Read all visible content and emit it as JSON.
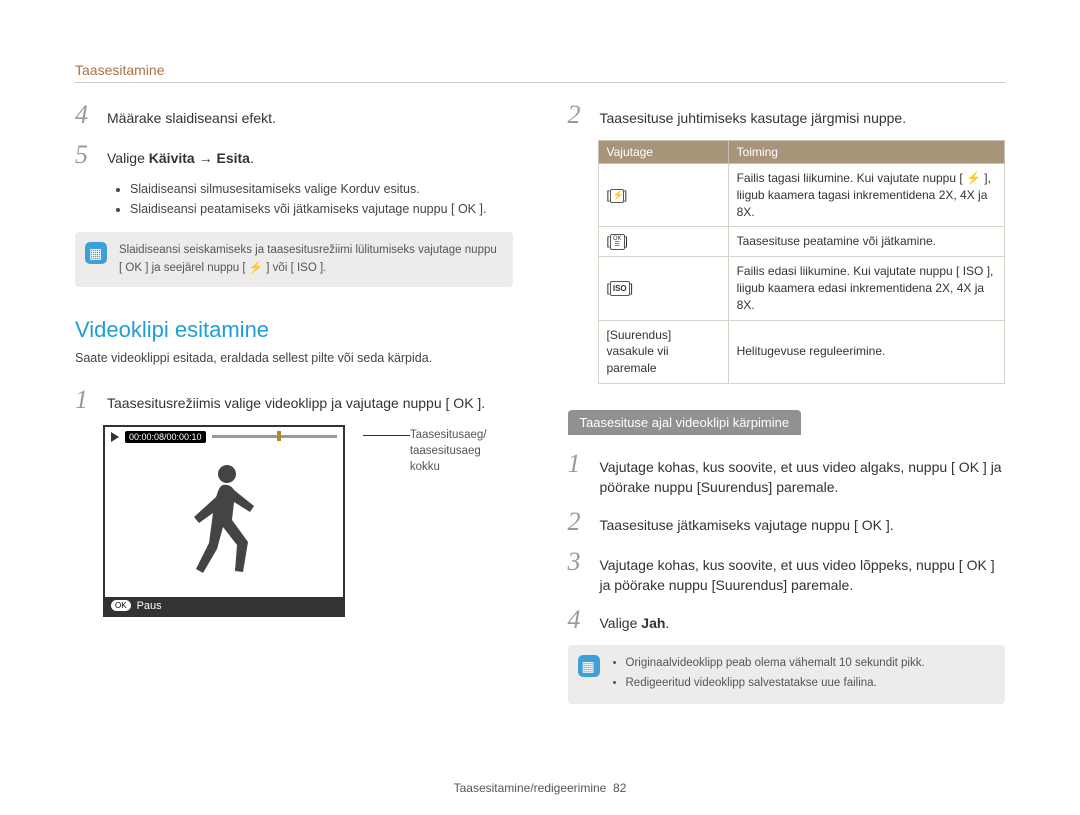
{
  "header": {
    "section": "Taasesitamine"
  },
  "left": {
    "step4": "Määrake slaidiseansi efekt.",
    "step5_pre": "Valige ",
    "step5_bold1": "Käivita",
    "step5_arrow": " → ",
    "step5_bold2": "Esita",
    "step5_post": ".",
    "bullets": [
      "Slaidiseansi silmusesitamiseks valige Korduv esitus.",
      "Slaidiseansi peatamiseks või jätkamiseks vajutage nuppu [ OK ]."
    ],
    "note": "Slaidiseansi seiskamiseks ja taasesitusrežiimi lülitumiseks vajutage nuppu [ OK ] ja seejärel nuppu [ ⚡ ] või [ ISO ].",
    "h2": "Videoklipi esitamine",
    "h2_sub": "Saate videoklippi esitada, eraldada sellest pilte või seda kärpida.",
    "step1": "Taasesitusrežiimis valige videoklipp ja vajutage nuppu [ OK ].",
    "screen": {
      "time": "00:00:08/00:00:10",
      "paus": "Paus"
    },
    "caption": "Taasesitusaeg/\ntaasesitusaeg kokku"
  },
  "right": {
    "step2": "Taasesituse juhtimiseks kasutage järgmisi nuppe.",
    "th1": "Vajutage",
    "th2": "Toiming",
    "rows": [
      {
        "k": "flash",
        "v": "Failis tagasi liikumine. Kui vajutate nuppu [ ⚡ ], liigub kaamera tagasi inkrementidena 2X, 4X ja 8X."
      },
      {
        "k": "ok",
        "v": "Taasesituse peatamine või jätkamine."
      },
      {
        "k": "iso",
        "v": "Failis edasi liikumine. Kui vajutate nuppu [ ISO ], liigub kaamera edasi inkrementidena 2X, 4X ja 8X."
      },
      {
        "k": "zoom",
        "ktxt": "[Suurendus] vasakule vii paremale",
        "v": "Helitugevuse reguleerimine."
      }
    ],
    "sect": "Taasesituse ajal videoklipi kärpimine",
    "c1": "Vajutage kohas, kus soovite, et uus video algaks, nuppu [ OK ] ja pöörake nuppu [Suurendus] paremale.",
    "c2": "Taasesituse jätkamiseks vajutage nuppu [ OK ].",
    "c3": "Vajutage kohas, kus soovite, et uus video lõppeks, nuppu [ OK ] ja pöörake nuppu [Suurendus] paremale.",
    "c4_pre": "Valige ",
    "c4_bold": "Jah",
    "c4_post": ".",
    "note_items": [
      "Originaalvideoklipp peab olema vähemalt 10 sekundit pikk.",
      "Redigeeritud videoklipp salvestatakse uue failina."
    ]
  },
  "footer": {
    "text": "Taasesitamine/redigeerimine",
    "page": "82"
  }
}
